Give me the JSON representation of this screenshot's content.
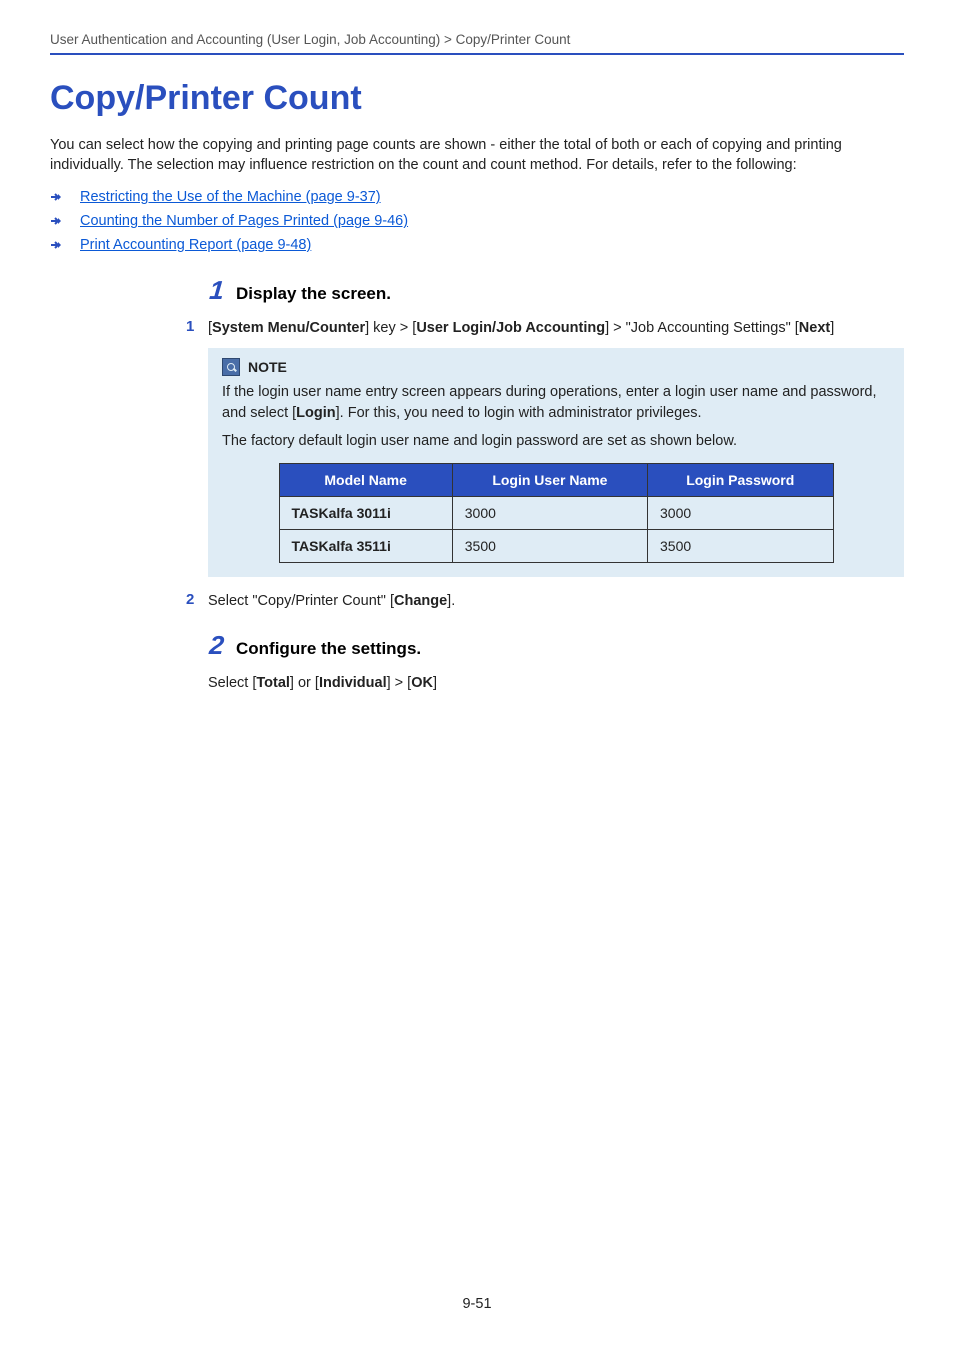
{
  "breadcrumb": "User Authentication and Accounting (User Login, Job Accounting) > Copy/Printer Count",
  "title": "Copy/Printer Count",
  "intro": "You can select how the copying and printing page counts are shown - either the total of both or each of copying and printing individually. The selection may influence restriction on the count and count method. For details, refer to the following:",
  "links": [
    "Restricting the Use of the Machine (page 9-37)",
    "Counting the Number of Pages Printed (page 9-46)",
    "Print Accounting Report (page 9-48)"
  ],
  "step1": {
    "num": "1",
    "title": "Display the screen.",
    "sub1": {
      "num": "1",
      "prefix": "[",
      "b1": "System Menu/Counter",
      "mid1": "] key > [",
      "b2": "User Login/Job Accounting",
      "mid2": "] > \"Job Accounting Settings\" [",
      "b3": "Next",
      "suffix": "]"
    },
    "note": {
      "label": "NOTE",
      "p1a": "If the login user name entry screen appears during operations, enter a login user name and password, and select [",
      "p1b": "Login",
      "p1c": "]. For this, you need to login with administrator privileges.",
      "p2": "The factory default login user name and login password are set as shown below."
    },
    "table": {
      "headers": [
        "Model Name",
        "Login User Name",
        "Login Password"
      ],
      "rows": [
        [
          "TASKalfa 3011i",
          "3000",
          "3000"
        ],
        [
          "TASKalfa 3511i",
          "3500",
          "3500"
        ]
      ]
    },
    "sub2": {
      "num": "2",
      "t1": "Select \"Copy/Printer Count\" [",
      "b1": "Change",
      "t2": "]."
    }
  },
  "step2": {
    "num": "2",
    "title": "Configure the settings.",
    "body": {
      "t1": "Select [",
      "b1": "Total",
      "t2": "] or [",
      "b2": "Individual",
      "t3": "] > [",
      "b3": "OK",
      "t4": "]"
    }
  },
  "pageNumber": "9-51"
}
